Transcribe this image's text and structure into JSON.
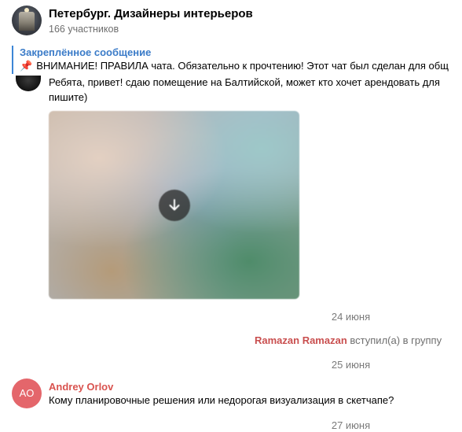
{
  "header": {
    "title": "Петербург. Дизайнеры интерьеров",
    "members": "166 участников",
    "avatar_icon": "group-avatar-photo"
  },
  "pinned": {
    "label": "Закреплённое сообщение",
    "pin_icon": "📌",
    "text": "ВНИМАНИЕ! ПРАВИЛА чата. Обязательно к прочтению!  Этот чат был сделан для общ"
  },
  "messages": [
    {
      "lines": [
        "Ребята, привет! сдаю помещение на Балтийской, может кто хочет арендовать для",
        "пишите)"
      ],
      "attachment": {
        "type": "photo",
        "icon": "download-arrow-icon"
      }
    }
  ],
  "dates": {
    "d1": "24 июня",
    "d2": "25 июня",
    "d3": "27 июня"
  },
  "service": {
    "name": "Ramazan Ramazan",
    "action": "вступил(а) в группу"
  },
  "last_message": {
    "avatar_initials": "AO",
    "author": "Andrey Orlov",
    "text": "Кому планировочные решения или недорогая визуализация в скетчапе?"
  },
  "colors": {
    "accent_blue": "#3a7bc8",
    "author_red": "#d9534f",
    "avatar_red": "#e4666b"
  }
}
